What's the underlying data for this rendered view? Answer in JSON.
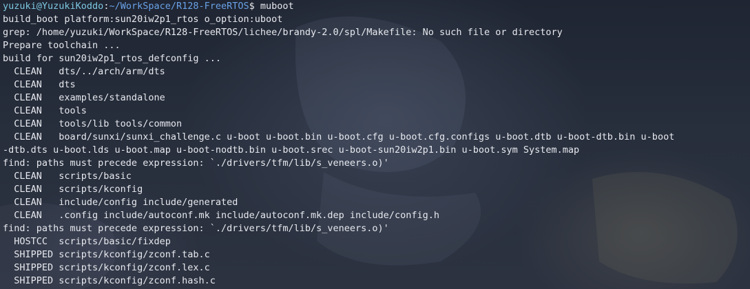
{
  "terminal": {
    "prompt": {
      "user_host": "yuzuki@YuzukiKoddo",
      "separator": ":",
      "path": "~/WorkSpace/R128-FreeRTOS",
      "symbol": "$ ",
      "command": "muboot"
    },
    "lines": [
      "build_boot platform:sun20iw2p1_rtos o_option:uboot",
      "grep: /home/yuzuki/WorkSpace/R128-FreeRTOS/lichee/brandy-2.0/spl/Makefile: No such file or directory",
      "Prepare toolchain ...",
      "build for sun20iw2p1_rtos_defconfig ...",
      "  CLEAN   dts/../arch/arm/dts",
      "  CLEAN   dts",
      "  CLEAN   examples/standalone",
      "  CLEAN   tools",
      "  CLEAN   tools/lib tools/common",
      "  CLEAN   board/sunxi/sunxi_challenge.c u-boot u-boot.bin u-boot.cfg u-boot.cfg.configs u-boot.dtb u-boot-dtb.bin u-boot",
      "-dtb.dts u-boot.lds u-boot.map u-boot-nodtb.bin u-boot.srec u-boot-sun20iw2p1.bin u-boot.sym System.map",
      "find: paths must precede expression: `./drivers/tfm/lib/s_veneers.o)'",
      "  CLEAN   scripts/basic",
      "  CLEAN   scripts/kconfig",
      "  CLEAN   include/config include/generated",
      "  CLEAN   .config include/autoconf.mk include/autoconf.mk.dep include/config.h",
      "find: paths must precede expression: `./drivers/tfm/lib/s_veneers.o)'",
      "  HOSTCC  scripts/basic/fixdep",
      "  SHIPPED scripts/kconfig/zconf.tab.c",
      "  SHIPPED scripts/kconfig/zconf.lex.c",
      "  SHIPPED scripts/kconfig/zconf.hash.c"
    ]
  },
  "colors": {
    "user_host": "#7ec8e3",
    "path": "#6aa2e8",
    "text": "#e7e9ee"
  }
}
